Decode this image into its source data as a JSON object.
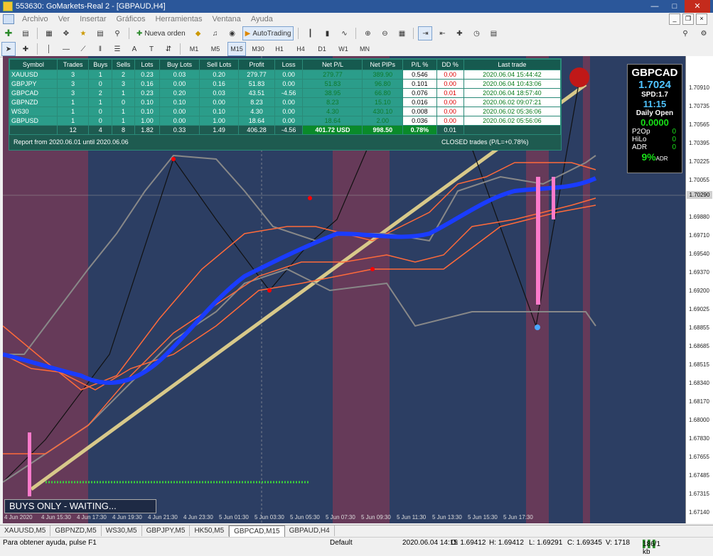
{
  "window": {
    "title": "553630: GoMarkets-Real 2 - [GBPAUD,H4]"
  },
  "menu": [
    "Archivo",
    "Ver",
    "Insertar",
    "Gráficos",
    "Herramientas",
    "Ventana",
    "Ayuda"
  ],
  "toolbar": {
    "new_order": "Nueva orden",
    "autotrading": "AutoTrading"
  },
  "timeframes": [
    "M1",
    "M5",
    "M15",
    "M30",
    "H1",
    "H4",
    "D1",
    "W1",
    "MN"
  ],
  "active_timeframe": "M15",
  "panel": {
    "headers": [
      "Symbol",
      "Trades",
      "Buys",
      "Sells",
      "Lots",
      "Buy Lots",
      "Sell Lots",
      "Profit",
      "Loss",
      "Net P/L",
      "Net PIPs",
      "P/L %",
      "DD %",
      "Last trade"
    ],
    "rows": [
      [
        "XAUUSD",
        "3",
        "1",
        "2",
        "0.23",
        "0.03",
        "0.20",
        "279.77",
        "0.00",
        "279.77",
        "389.90",
        "0.546",
        "0.00",
        "2020.06.04 15:44:42"
      ],
      [
        "GBPJPY",
        "3",
        "0",
        "3",
        "0.16",
        "0.00",
        "0.16",
        "51.83",
        "0.00",
        "51.83",
        "96.80",
        "0.101",
        "0.00",
        "2020.06.04 10:43:06"
      ],
      [
        "GBPCAD",
        "3",
        "2",
        "1",
        "0.23",
        "0.20",
        "0.03",
        "43.51",
        "-4.56",
        "38.95",
        "66.80",
        "0.076",
        "0.01",
        "2020.06.04 18:57:40"
      ],
      [
        "GBPNZD",
        "1",
        "1",
        "0",
        "0.10",
        "0.10",
        "0.00",
        "8.23",
        "0.00",
        "8.23",
        "15.10",
        "0.016",
        "0.00",
        "2020.06.02 09:07:21"
      ],
      [
        "WS30",
        "1",
        "0",
        "1",
        "0.10",
        "0.00",
        "0.10",
        "4.30",
        "0.00",
        "4.30",
        "430.10",
        "0.008",
        "0.00",
        "2020.06.02 05:36:06"
      ],
      [
        "GBPUSD",
        "1",
        "0",
        "1",
        "1.00",
        "0.00",
        "1.00",
        "18.64",
        "0.00",
        "18.64",
        "2.00",
        "0.036",
        "0.00",
        "2020.06.02 05:56:06"
      ]
    ],
    "totals": [
      "",
      "12",
      "4",
      "8",
      "1.82",
      "0.33",
      "1.49",
      "406.28",
      "-4.56",
      "401.72 USD",
      "998.50",
      "0.78%",
      "0.01",
      ""
    ],
    "report": "Report from 2020.06.01 until 2020.06.06",
    "closed": "CLOSED trades (P/L=+0.78%)"
  },
  "info": {
    "symbol": "GBPCAD",
    "price": "1.7024",
    "spd": "SPD:1.7",
    "time": "11:15",
    "daily_open_label": "Daily Open",
    "daily_open": "0.0000",
    "p2op_label": "P2Op",
    "p2op": "0",
    "hilo_label": "HiLo",
    "hilo": "0",
    "adr_label": "ADR",
    "adr": "0",
    "pct": "9%",
    "adr_small": "ADR"
  },
  "banner": "BUYS ONLY - WAITING...",
  "price_scale": {
    "labels": [
      "1.70910",
      "1.70735",
      "1.70565",
      "1.70395",
      "1.70225",
      "1.70055",
      "1.69880",
      "1.69710",
      "1.69540",
      "1.69370",
      "1.69200",
      "1.69025",
      "1.68855",
      "1.68685",
      "1.68515",
      "1.68340",
      "1.68170",
      "1.68000",
      "1.67830",
      "1.67655",
      "1.67485",
      "1.67315",
      "1.67140"
    ],
    "current": "1.70290"
  },
  "price_scale_shown": [
    "1.70910",
    "1.70735",
    "1.70565",
    "1.70395",
    "1.70225",
    "1.70055",
    "1.69880",
    "1.69710",
    "1.69540",
    "1.69370",
    "1.69200",
    "1.69025",
    "1.68855",
    "1.68685",
    "1.68515",
    "1.68340",
    "1.68170",
    "1.68000",
    "1.67830",
    "1.67655",
    "1.67485",
    "1.67315",
    "1.67140"
  ],
  "scale_values": [
    "1.70910",
    "1.70735",
    "1.70565",
    "1.70395",
    "1.70225",
    "1.70055",
    "1.69880",
    "1.69710",
    "1.69540",
    "1.69370",
    "1.69200",
    "1.69025",
    "1.68855",
    "1.68685",
    "1.68515",
    "1.68340",
    "1.68170",
    "1.68000",
    "1.67830",
    "1.67655",
    "1.67485",
    "1.67315",
    "1.67140"
  ],
  "axis": {
    "labels": [
      "1.70910",
      "1.70735",
      "1.70565",
      "1.70395",
      "1.70225",
      "1.70055",
      "1.69880",
      "1.69710",
      "1.69540",
      "1.69370",
      "1.69200",
      "1.69025",
      "1.68855",
      "1.68685",
      "1.68515",
      "1.68340",
      "1.68170",
      "1.68000",
      "1.67830",
      "1.67655",
      "1.67485",
      "1.67315",
      "1.67140"
    ]
  },
  "price_ticks": [
    "1.70910",
    "1.70735",
    "1.70565",
    "1.70395",
    "1.70225",
    "1.70055",
    "1.69880",
    "1.69710",
    "1.69540",
    "1.69370",
    "1.69200",
    "1.69025",
    "1.68855",
    "1.68685",
    "1.68515",
    "1.68340",
    "1.68170",
    "1.68000",
    "1.67830",
    "1.67655",
    "1.67485",
    "1.67315",
    "1.67140"
  ],
  "yticks": [
    "1.70910",
    "1.70735",
    "1.70565",
    "1.70395",
    "1.70225",
    "1.70055",
    "1.69880",
    "1.69710",
    "1.69540",
    "1.69370",
    "1.69200",
    "1.69025",
    "1.68855",
    "1.68685",
    "1.68515",
    "1.68340",
    "1.68170",
    "1.68000",
    "1.67830",
    "1.67655",
    "1.67485",
    "1.67315",
    "1.67140"
  ],
  "price_axis": [
    "1.70910",
    "1.70735",
    "1.70565",
    "1.70395",
    "1.70225",
    "1.70055",
    "1.69880",
    "1.69710",
    "1.69540",
    "1.69370",
    "1.69200",
    "1.69025",
    "1.68855",
    "1.68685",
    "1.68515",
    "1.68340",
    "1.68170",
    "1.68000",
    "1.67830",
    "1.67655",
    "1.67485",
    "1.67315",
    "1.67140"
  ],
  "time_labels": [
    "4 Jun 2020",
    "4 Jun 15:30",
    "4 Jun 17:30",
    "4 Jun 19:30",
    "4 Jun 21:30",
    "4 Jun 23:30",
    "5 Jun 01:30",
    "5 Jun 03:30",
    "5 Jun 05:30",
    "5 Jun 07:30",
    "5 Jun 09:30",
    "5 Jun 11:30",
    "5 Jun 13:30",
    "5 Jun 15:30",
    "5 Jun 17:30"
  ],
  "tabs": [
    "XAUUSD,M5",
    "GBPNZD,M5",
    "WS30,M5",
    "GBPJPY,M5",
    "HK50,M5",
    "GBPCAD,M15",
    "GBPAUD,H4"
  ],
  "active_tab": "GBPCAD,M15",
  "status": {
    "help": "Para obtener ayuda, pulse F1",
    "profile": "Default",
    "datetime": "2020.06.04 14:15",
    "open": "O: 1.69412",
    "high": "H: 1.69412",
    "low": "L: 1.69291",
    "close": "C: 1.69345",
    "volume": "V: 1718",
    "traffic": "186/1 kb"
  }
}
